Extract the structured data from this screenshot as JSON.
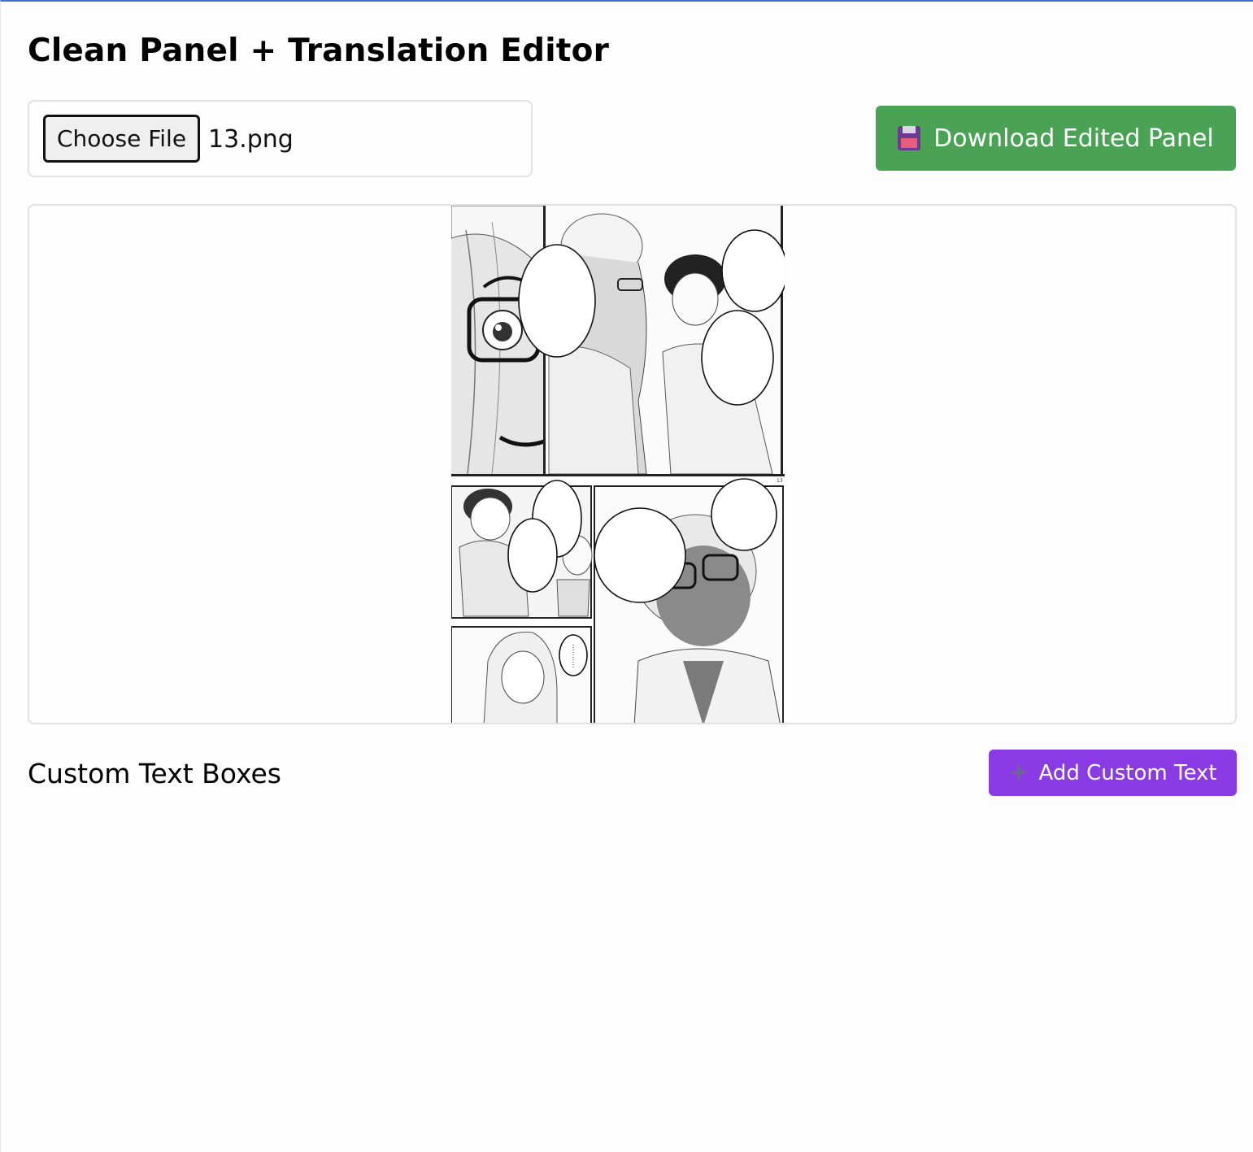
{
  "header": {
    "title": "Clean Panel + Translation Editor"
  },
  "file_input": {
    "button_label": "Choose File",
    "file_name": "13.png"
  },
  "toolbar": {
    "download_label": "Download Edited Panel",
    "download_icon": "floppy-disk-icon",
    "download_color": "#4aa354"
  },
  "custom_text": {
    "section_title": "Custom Text Boxes",
    "add_label": "Add Custom Text",
    "add_icon": "plus-icon",
    "add_color": "#8b3be6",
    "items": []
  },
  "panel": {
    "page_number": "13"
  }
}
